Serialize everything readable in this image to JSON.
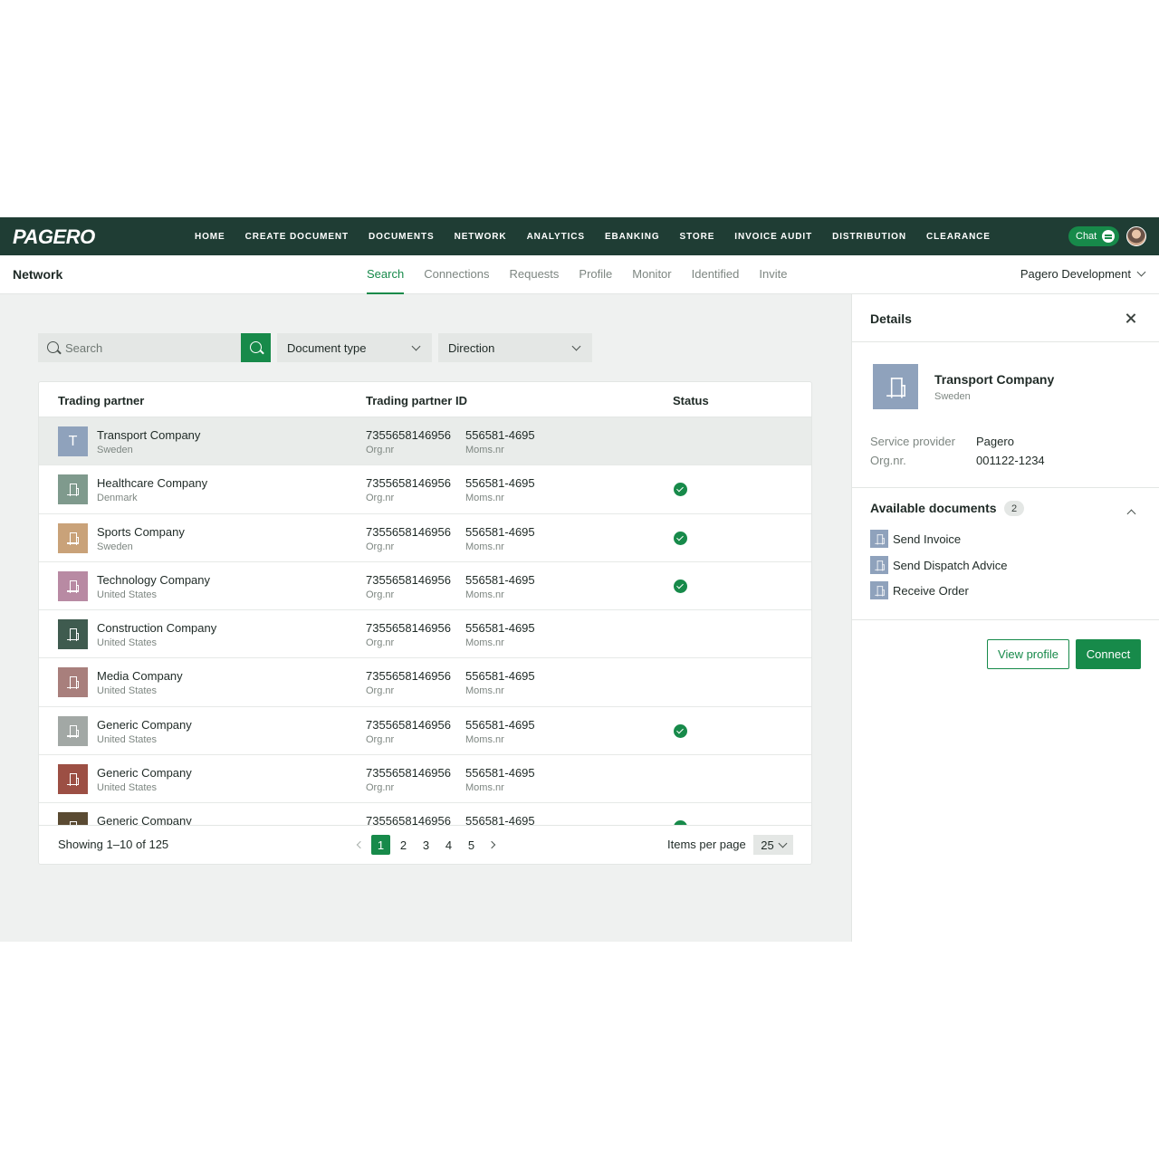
{
  "brand": {
    "logo_text": "PAGERO",
    "accent": "#178a4a",
    "nav_bg": "#1f3d34"
  },
  "topnav": {
    "items": [
      "HOME",
      "CREATE DOCUMENT",
      "DOCUMENTS",
      "NETWORK",
      "ANALYTICS",
      "EBANKING",
      "STORE",
      "INVOICE AUDIT",
      "DISTRIBUTION",
      "CLEARANCE"
    ],
    "chat_label": "Chat"
  },
  "subnav": {
    "title": "Network",
    "tabs": [
      "Search",
      "Connections",
      "Requests",
      "Profile",
      "Monitor",
      "Identified",
      "Invite"
    ],
    "active_tab": "Search",
    "org": "Pagero Development"
  },
  "filters": {
    "search_placeholder": "Search",
    "document_type": "Document type",
    "direction": "Direction"
  },
  "table": {
    "headers": [
      "Trading partner",
      "Trading partner ID",
      "Status"
    ],
    "id_label_1": "Org.nr",
    "id_label_2": "Moms.nr",
    "rows": [
      {
        "name": "Transport Company",
        "country": "Sweden",
        "id1": "7355658146956",
        "id2": "556581-4695",
        "status": "",
        "color": "#8fa2bc",
        "initial": "T",
        "selected": true
      },
      {
        "name": "Healthcare Company",
        "country": "Denmark",
        "id1": "7355658146956",
        "id2": "556581-4695",
        "status": "ok",
        "color": "#7f9a8d"
      },
      {
        "name": "Sports Company",
        "country": "Sweden",
        "id1": "7355658146956",
        "id2": "556581-4695",
        "status": "ok",
        "color": "#c9a279"
      },
      {
        "name": "Technology Company",
        "country": "United States",
        "id1": "7355658146956",
        "id2": "556581-4695",
        "status": "ok",
        "color": "#b88aa3"
      },
      {
        "name": "Construction Company",
        "country": "United States",
        "id1": "7355658146956",
        "id2": "556581-4695",
        "status": "",
        "color": "#3f5b4f"
      },
      {
        "name": "Media Company",
        "country": "United States",
        "id1": "7355658146956",
        "id2": "556581-4695",
        "status": "",
        "color": "#a87f7c"
      },
      {
        "name": "Generic Company",
        "country": "United States",
        "id1": "7355658146956",
        "id2": "556581-4695",
        "status": "ok",
        "color": "#a2a8a5"
      },
      {
        "name": "Generic Company",
        "country": "United States",
        "id1": "7355658146956",
        "id2": "556581-4695",
        "status": "",
        "color": "#9c4f44"
      },
      {
        "name": "Generic Company",
        "country": "",
        "id1": "7355658146956",
        "id2": "556581-4695",
        "status": "ok",
        "color": "#5a4a32"
      }
    ]
  },
  "pagination": {
    "showing": "Showing 1–10 of 125",
    "pages": [
      "1",
      "2",
      "3",
      "4",
      "5"
    ],
    "current": "1",
    "items_per_page_label": "Items per page",
    "items_per_page": "25"
  },
  "details": {
    "title": "Details",
    "company_name": "Transport Company",
    "company_country": "Sweden",
    "service_provider_label": "Service provider",
    "service_provider": "Pagero",
    "org_label": "Org.nr.",
    "org_value": "001122-1234",
    "available_title": "Available documents",
    "available_count": "2",
    "documents": [
      "Send Invoice",
      "Send Dispatch Advice",
      "Receive Order"
    ],
    "view_profile": "View profile",
    "connect": "Connect"
  }
}
